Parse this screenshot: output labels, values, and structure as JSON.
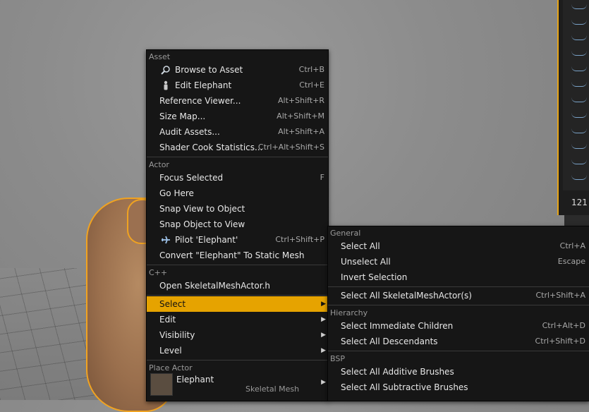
{
  "right_panel": {
    "value": "121"
  },
  "context_menu": {
    "sections": {
      "asset": "Asset",
      "actor": "Actor",
      "cpp": "C++",
      "place_actor": "Place Actor"
    },
    "asset_items": [
      {
        "label": "Browse to Asset",
        "shortcut": "Ctrl+B",
        "icon": "magnifier-icon"
      },
      {
        "label": "Edit Elephant",
        "shortcut": "Ctrl+E",
        "icon": "person-icon"
      },
      {
        "label": "Reference Viewer...",
        "shortcut": "Alt+Shift+R"
      },
      {
        "label": "Size Map...",
        "shortcut": "Alt+Shift+M"
      },
      {
        "label": "Audit Assets...",
        "shortcut": "Alt+Shift+A"
      },
      {
        "label": "Shader Cook Statistics...",
        "shortcut": "Ctrl+Alt+Shift+S"
      }
    ],
    "actor_items": [
      {
        "label": "Focus Selected",
        "shortcut": "F"
      },
      {
        "label": "Go Here",
        "shortcut": ""
      },
      {
        "label": "Snap View to Object",
        "shortcut": ""
      },
      {
        "label": "Snap Object to View",
        "shortcut": ""
      },
      {
        "label": "Pilot 'Elephant'",
        "shortcut": "Ctrl+Shift+P",
        "icon": "plane-icon"
      },
      {
        "label": "Convert \"Elephant\" To Static Mesh",
        "shortcut": ""
      }
    ],
    "cpp_items": [
      {
        "label": "Open SkeletalMeshActor.h"
      }
    ],
    "submenu_items": [
      {
        "label": "Select",
        "selected": true
      },
      {
        "label": "Edit"
      },
      {
        "label": "Visibility"
      },
      {
        "label": "Level"
      }
    ],
    "place_actor_items": [
      {
        "label": "Elephant",
        "sublabel": "Skeletal Mesh"
      }
    ]
  },
  "select_submenu": {
    "sections": {
      "general": "General",
      "hierarchy": "Hierarchy",
      "bsp": "BSP"
    },
    "general_items": [
      {
        "label": "Select All",
        "shortcut": "Ctrl+A"
      },
      {
        "label": "Unselect All",
        "shortcut": "Escape"
      },
      {
        "label": "Invert Selection",
        "shortcut": ""
      }
    ],
    "general_items2": [
      {
        "label": "Select All SkeletalMeshActor(s)",
        "shortcut": "Ctrl+Shift+A"
      }
    ],
    "hierarchy_items": [
      {
        "label": "Select Immediate Children",
        "shortcut": "Ctrl+Alt+D"
      },
      {
        "label": "Select All Descendants",
        "shortcut": "Ctrl+Shift+D"
      }
    ],
    "bsp_items": [
      {
        "label": "Select All Additive Brushes",
        "shortcut": ""
      },
      {
        "label": "Select All Subtractive Brushes",
        "shortcut": ""
      }
    ]
  },
  "colors": {
    "accent": "#e6a300",
    "menu_bg": "#161616",
    "selection_outline": "#f0a321"
  }
}
